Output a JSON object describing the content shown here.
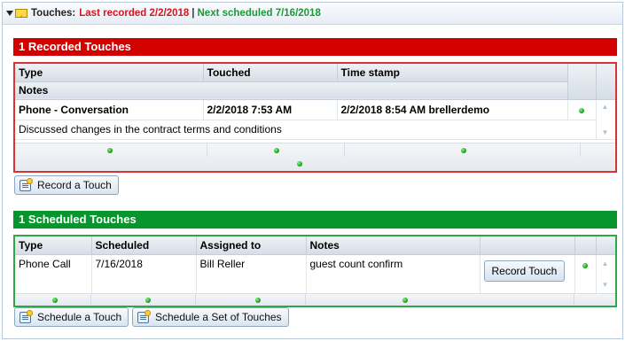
{
  "header": {
    "label": "Touches:",
    "last_recorded": "Last recorded 2/2/2018",
    "separator": "|",
    "next_scheduled": "Next scheduled 7/16/2018"
  },
  "recorded": {
    "title": "1 Recorded Touches",
    "columns": [
      "Type",
      "Touched",
      "Time stamp"
    ],
    "notes_header": "Notes",
    "rows": [
      {
        "type": "Phone - Conversation",
        "touched": "2/2/2018 7:53 AM",
        "time_stamp": "2/2/2018 8:54 AM brellerdemo",
        "notes": "Discussed changes in the contract terms and conditions"
      }
    ],
    "button": "Record a Touch"
  },
  "scheduled": {
    "title": "1 Scheduled Touches",
    "columns": [
      "Type",
      "Scheduled",
      "Assigned to",
      "Notes"
    ],
    "rows": [
      {
        "type": "Phone Call",
        "scheduled": "7/16/2018",
        "assigned_to": "Bill Reller",
        "notes": "guest count confirm",
        "action": "Record Touch"
      }
    ],
    "buttons": {
      "schedule": "Schedule a Touch",
      "schedule_set": "Schedule a Set of Touches"
    }
  },
  "colors": {
    "recorded_accent": "#d30000",
    "scheduled_accent": "#07952e",
    "last_recorded_text": "#d8141c",
    "next_scheduled_text": "#1a9a33"
  },
  "icons": [
    "collapse-triangle-icon",
    "envelope-icon",
    "status-dot-icon",
    "scroll-up-icon",
    "scroll-down-icon",
    "notepad-icon"
  ]
}
